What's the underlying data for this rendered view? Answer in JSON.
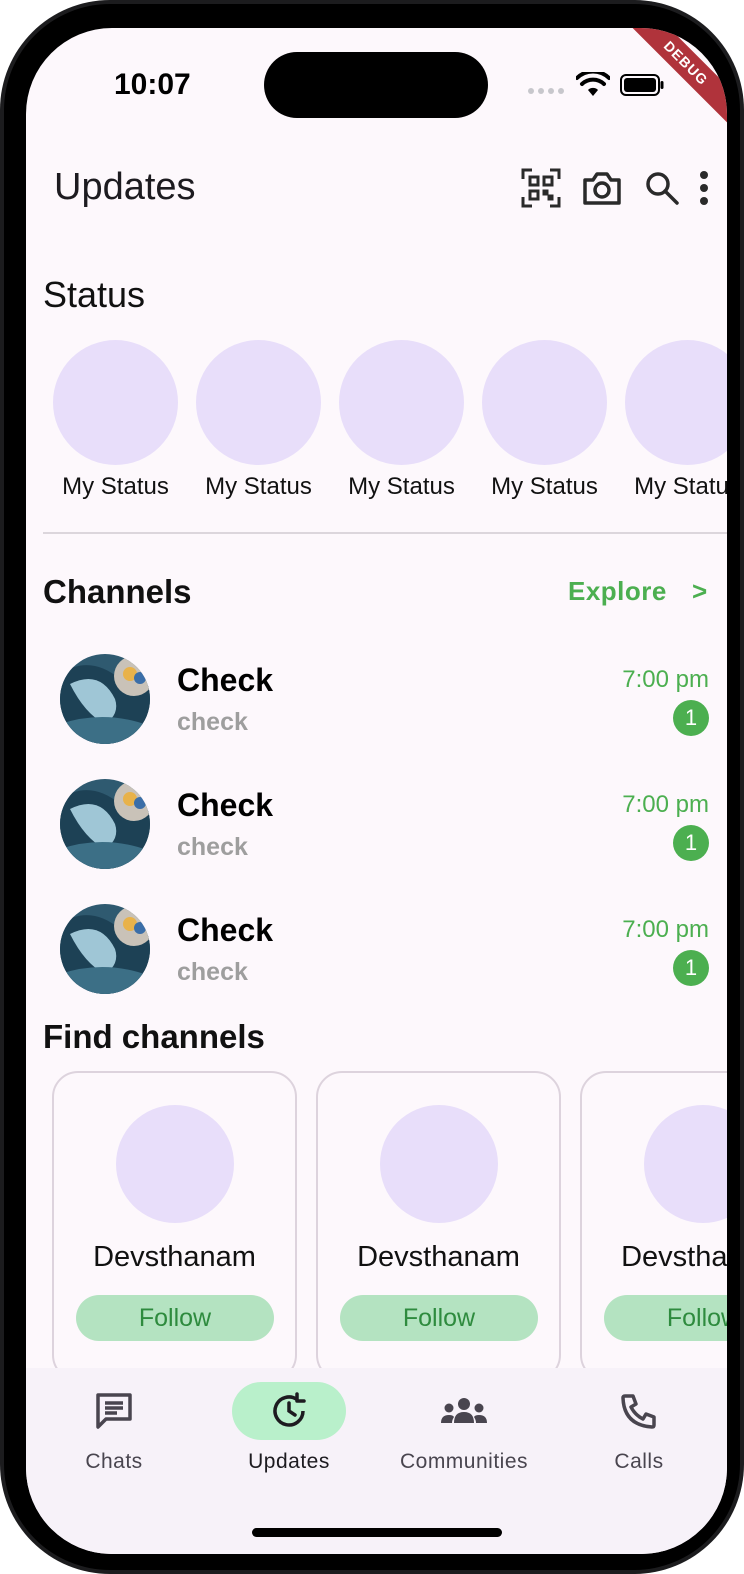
{
  "status_bar": {
    "time": "10:07",
    "debug_label": "DEBUG"
  },
  "app_bar": {
    "title": "Updates",
    "icons": [
      "qr-scanner-icon",
      "camera-icon",
      "search-icon",
      "more-vert-icon"
    ]
  },
  "status_section": {
    "title": "Status",
    "items": [
      {
        "label": "My Status"
      },
      {
        "label": "My Status"
      },
      {
        "label": "My Status"
      },
      {
        "label": "My Status"
      },
      {
        "label": "My Status"
      }
    ]
  },
  "channels_section": {
    "title": "Channels",
    "explore_label": "Explore",
    "explore_chevron": ">",
    "items": [
      {
        "name": "Check",
        "subtitle": "check",
        "time": "7:00 pm",
        "unread": "1"
      },
      {
        "name": "Check",
        "subtitle": "check",
        "time": "7:00 pm",
        "unread": "1"
      },
      {
        "name": "Check",
        "subtitle": "check",
        "time": "7:00 pm",
        "unread": "1"
      }
    ]
  },
  "find_channels": {
    "title": "Find channels",
    "cards": [
      {
        "name": "Devsthanam",
        "button": "Follow"
      },
      {
        "name": "Devsthanam",
        "button": "Follow"
      },
      {
        "name": "Devsthanam",
        "button": "Follow"
      }
    ]
  },
  "bottom_nav": {
    "active": "Updates",
    "items": [
      {
        "label": "Chats",
        "icon": "chat-icon"
      },
      {
        "label": "Updates",
        "icon": "updates-icon"
      },
      {
        "label": "Communities",
        "icon": "communities-icon"
      },
      {
        "label": "Calls",
        "icon": "phone-icon"
      }
    ]
  },
  "colors": {
    "accent_green": "#4caf50",
    "active_pill": "#b9f0cb",
    "follow_bg": "#b4e3c1",
    "placeholder_lavender": "#e8defa",
    "screen_bg": "#fdf8fc"
  }
}
